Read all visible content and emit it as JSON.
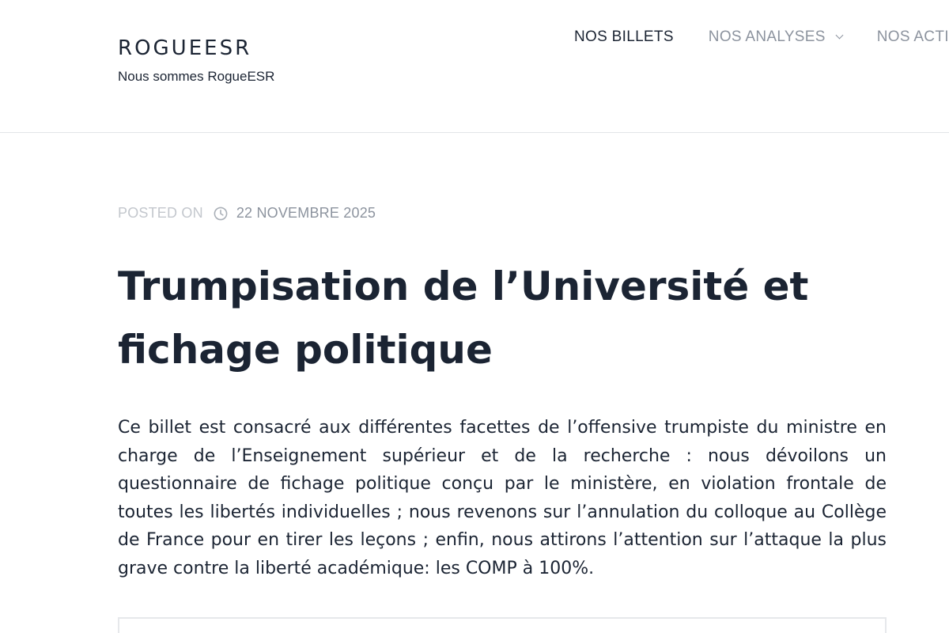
{
  "site": {
    "title": "ROGUEESR",
    "tagline": "Nous sommes RogueESR"
  },
  "nav": {
    "items": [
      {
        "label": "NOS BILLETS",
        "active": true
      },
      {
        "label": "NOS ANALYSES",
        "has_submenu": true
      },
      {
        "label": "NOS ACTIONS"
      }
    ]
  },
  "post": {
    "meta_label": "POSTED ON",
    "meta_icon": "clock-icon",
    "date": "22 NOVEMBRE 2025",
    "title": "Trumpisation de l’Université et fichage politique",
    "excerpt": "Ce billet est consacré aux différentes facettes de l’offensive trumpiste du ministre en charge de l’Enseignement supérieur et de la recherche : nous dévoilons un questionnaire de fichage politique conçu par le ministère, en violation frontale de toutes les libertés individuelles ; nous revenons sur l’annulation du colloque au Collège de France pour en tirer les leçons ; enfin, nous attirons l’attention sur l’attaque la plus grave contre la liberté académique: les COMP à 100%."
  },
  "colors": {
    "text": "#1b2433",
    "muted": "#8c939e",
    "faint": "#c3c7cd",
    "divider": "#e3e5e8"
  }
}
